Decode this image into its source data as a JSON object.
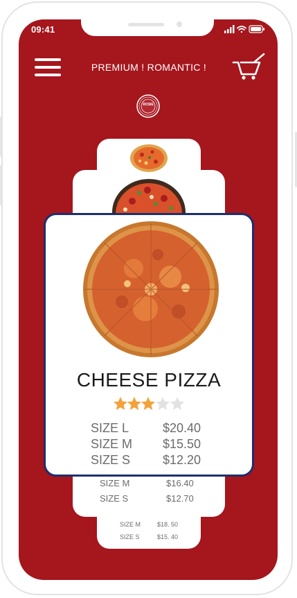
{
  "status_bar": {
    "time": "09:41"
  },
  "header": {
    "title": "PREMIUM ! ROMANTIC !",
    "logo_text": "ROSIE"
  },
  "featured": {
    "name": "CHEESE PIZZA",
    "rating": 3,
    "rating_max": 5,
    "sizes": [
      {
        "size": "SIZE L",
        "price": "$20.40"
      },
      {
        "size": "SIZE M",
        "price": "$15.50"
      },
      {
        "size": "SIZE S",
        "price": "$12.20"
      }
    ]
  },
  "card_behind_1": {
    "sizes": [
      {
        "size": "SIZE M",
        "price": "$16.40"
      },
      {
        "size": "SIZE S",
        "price": "$12.70"
      }
    ]
  },
  "card_behind_2": {
    "sizes": [
      {
        "size": "SIZE M",
        "price": "$18. 50"
      },
      {
        "size": "SIZE S",
        "price": "$15. 40"
      }
    ]
  },
  "colors": {
    "background": "#a5161d",
    "card_border": "#1c2f6e",
    "star_filled": "#f3a23a",
    "star_empty": "#e2e2e2"
  },
  "icons": [
    "menu-icon",
    "cart-icon",
    "signal-icon",
    "wifi-icon",
    "battery-icon",
    "star-icon"
  ]
}
